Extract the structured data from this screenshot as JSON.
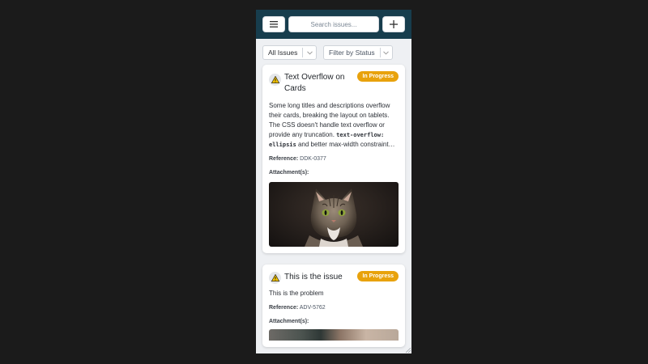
{
  "topbar": {
    "menu_icon": "hamburger-icon",
    "search_placeholder": "Search issues...",
    "add_icon": "plus-icon"
  },
  "filters": {
    "issues_select": "All Issues",
    "status_select": "Filter by Status"
  },
  "cards": [
    {
      "icon": "warning-icon",
      "title": "Text Overflow on Cards",
      "status": "In Progress",
      "status_color": "#e8a20c",
      "description_start": "Some long titles and descriptions overflow their cards, breaking the layout on tablets. The CSS doesn't handle text overflow or provide any truncation. ",
      "description_code": "text-overflow: ellipsis",
      "description_end": " and better max-width constraint…",
      "reference_label": "Reference:",
      "reference_value": "DDK-0377",
      "attachments_label": "Attachment(s):"
    },
    {
      "icon": "warning-icon",
      "title": "This is the issue",
      "status": "In Progress",
      "status_color": "#e8a20c",
      "description": "This is the problem",
      "reference_label": "Reference:",
      "reference_value": "ADV-5762",
      "attachments_label": "Attachment(s):"
    }
  ],
  "colors": {
    "header": "#173d4d",
    "background": "#1b1b1b",
    "badge": "#e8a20c"
  }
}
